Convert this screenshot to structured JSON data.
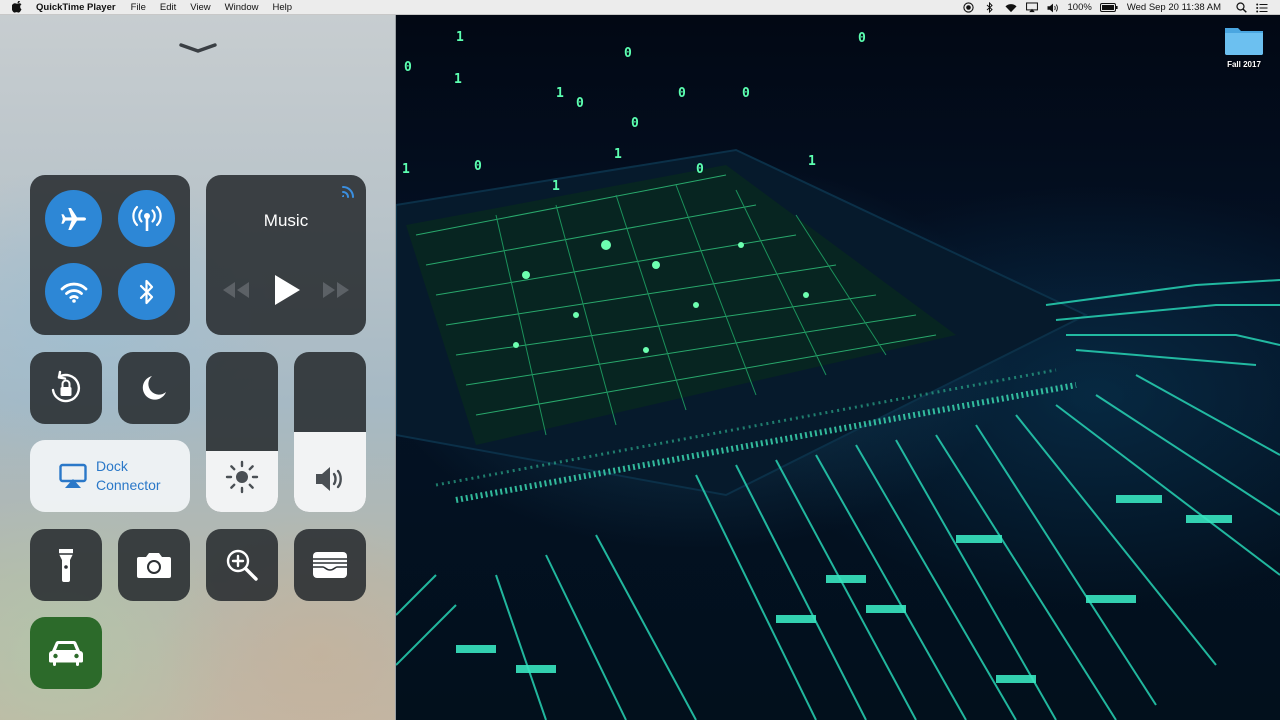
{
  "menubar": {
    "apple_icon": "apple-logo-icon",
    "app_name": "QuickTime Player",
    "menus": [
      "File",
      "Edit",
      "View",
      "Window",
      "Help"
    ],
    "status_icons": [
      "screen-record-icon",
      "bluetooth-status-icon",
      "wifi-status-icon",
      "airplay-status-icon",
      "volume-status-icon"
    ],
    "battery_percent": "100%",
    "datetime": "Wed Sep 20  11:38 AM"
  },
  "control_center": {
    "connectivity": {
      "airplane_icon": "airplane-icon",
      "cellular_icon": "cellular-antenna-icon",
      "wifi_icon": "wifi-icon",
      "bluetooth_icon": "bluetooth-icon",
      "active_color": "#2d87d6"
    },
    "music": {
      "title": "Music",
      "controls": [
        "rewind-icon",
        "play-icon",
        "fast-forward-icon"
      ]
    },
    "toggles": [
      "orientation-lock-icon",
      "do-not-disturb-moon-icon"
    ],
    "airplay_target": {
      "label_line1": "Dock",
      "label_line2": "Connector",
      "color": "#2a78c8"
    },
    "brightness_level": 0.38,
    "volume_level": 0.5,
    "shortcuts": [
      "flashlight-icon",
      "camera-icon",
      "magnifier-icon",
      "wallet-icon"
    ],
    "car_mode": {
      "icon": "car-icon",
      "color": "#2c6a2a"
    }
  },
  "desktop": {
    "folder_label": "Fall 2017",
    "wallpaper_digits": [
      "1",
      "0",
      "0",
      "1",
      "0",
      "0",
      "0",
      "0",
      "1",
      "0",
      "1",
      "1",
      "0",
      "1",
      "0",
      "1"
    ]
  }
}
